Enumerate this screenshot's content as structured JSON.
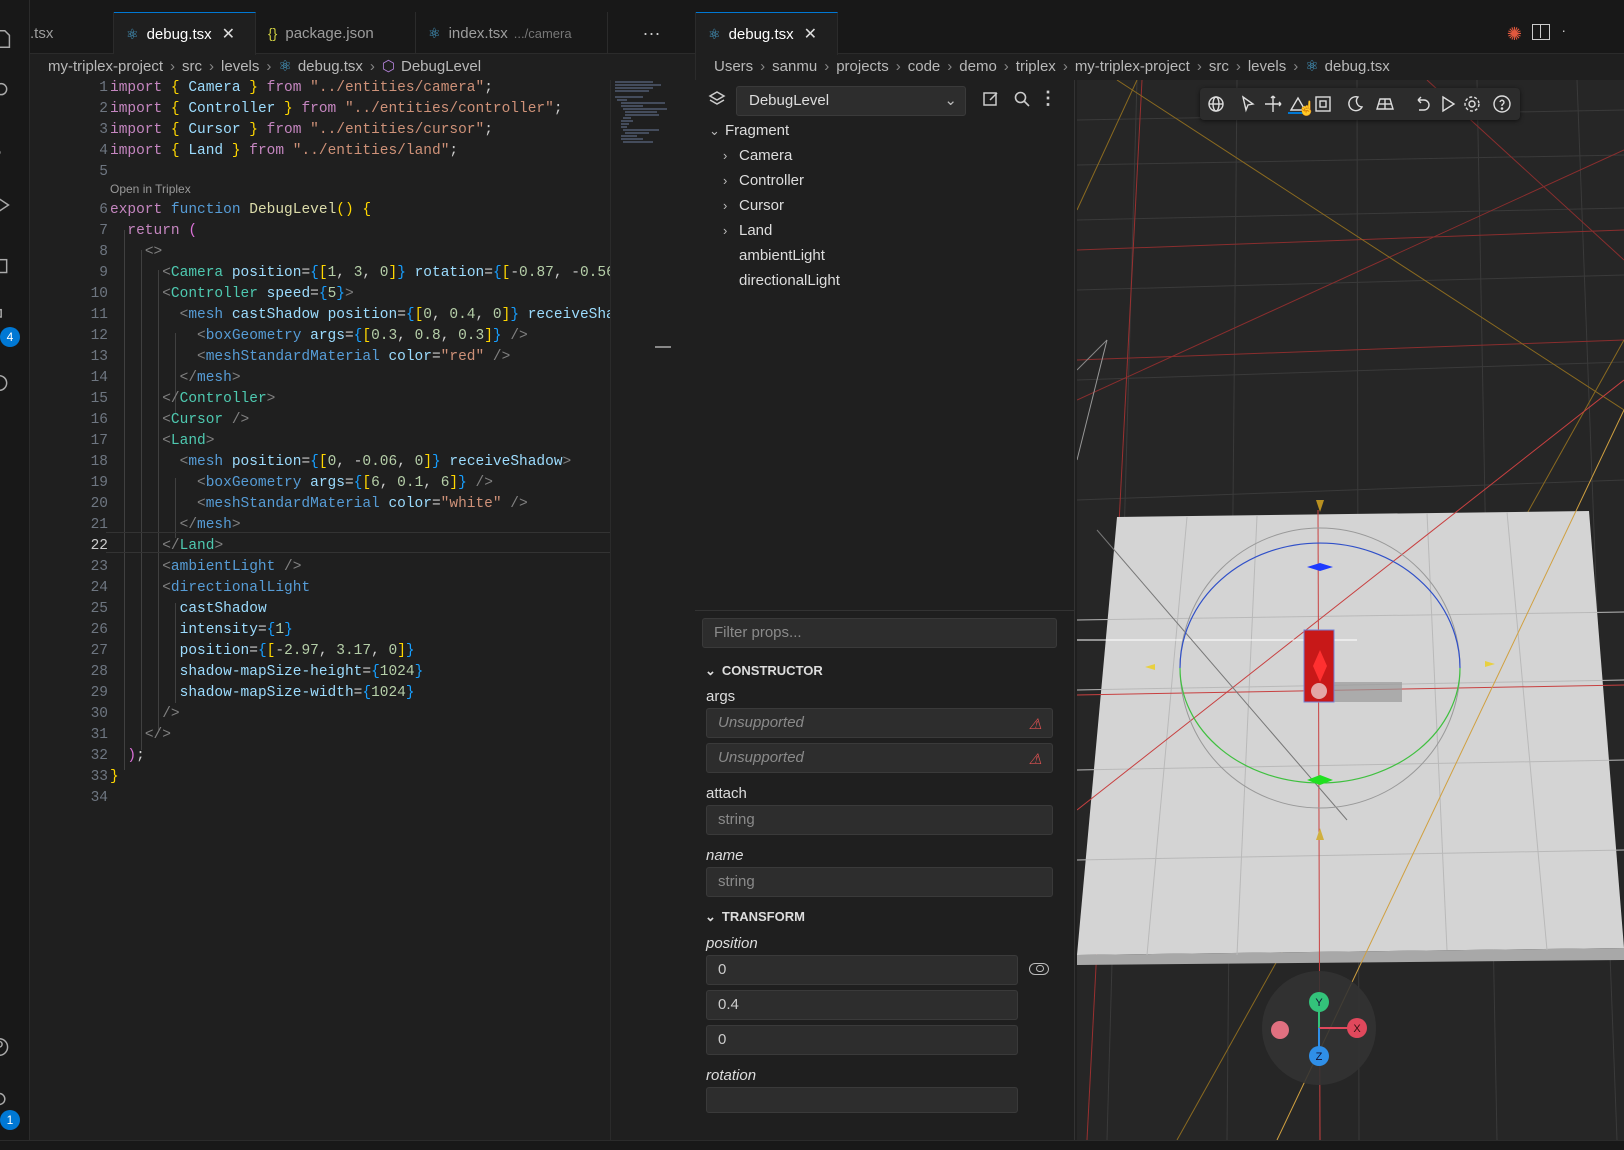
{
  "tabs_left": [
    {
      "name": "tab-partial-tsx",
      "label": ".tsx",
      "icon": "",
      "active": false,
      "close": false,
      "desc": ""
    },
    {
      "name": "tab-debug-tsx",
      "label": "debug.tsx",
      "icon": "react-icon",
      "active": true,
      "close": true,
      "desc": ""
    },
    {
      "name": "tab-package-json",
      "label": "package.json",
      "icon": "json-icon",
      "active": false,
      "close": false,
      "desc": ""
    },
    {
      "name": "tab-index-tsx",
      "label": "index.tsx",
      "icon": "react-icon",
      "active": false,
      "close": false,
      "desc": ".../camera"
    }
  ],
  "tabs_more": "···",
  "breadcrumb_left": [
    "my-triplex-project",
    "src",
    "levels",
    "debug.tsx",
    "DebugLevel"
  ],
  "code_lens": "Open in Triplex",
  "current_line": 22,
  "line_numbers": [
    "1",
    "2",
    "3",
    "4",
    "5",
    "6",
    "7",
    "8",
    "9",
    "10",
    "11",
    "12",
    "13",
    "14",
    "15",
    "16",
    "17",
    "18",
    "19",
    "20",
    "21",
    "22",
    "23",
    "24",
    "25",
    "26",
    "27",
    "28",
    "29",
    "30",
    "31",
    "32",
    "33",
    "34"
  ],
  "right_tab": {
    "label": "debug.tsx",
    "close": "✕"
  },
  "breadcrumb_right": [
    "Users",
    "sanmu",
    "projects",
    "code",
    "demo",
    "triplex",
    "my-triplex-project",
    "src",
    "levels",
    "debug.tsx"
  ],
  "scene": {
    "selector_value": "DebugLevel",
    "tree": [
      {
        "label": "Fragment",
        "expanded": true,
        "has_children": true,
        "depth": 0
      },
      {
        "label": "Camera",
        "expanded": false,
        "has_children": true,
        "depth": 1
      },
      {
        "label": "Controller",
        "expanded": false,
        "has_children": true,
        "depth": 1
      },
      {
        "label": "Cursor",
        "expanded": false,
        "has_children": true,
        "depth": 1
      },
      {
        "label": "Land",
        "expanded": false,
        "has_children": true,
        "depth": 1
      },
      {
        "label": "ambientLight",
        "expanded": false,
        "has_children": false,
        "depth": 1
      },
      {
        "label": "directionalLight",
        "expanded": false,
        "has_children": false,
        "depth": 1
      }
    ]
  },
  "props": {
    "filter_placeholder": "Filter props...",
    "constructor_title": "CONSTRUCTOR",
    "args_label": "args",
    "args_values": [
      "Unsupported",
      "Unsupported"
    ],
    "attach_label": "attach",
    "attach_placeholder": "string",
    "name_label": "name",
    "name_placeholder": "string",
    "transform_title": "TRANSFORM",
    "position_label": "position",
    "position_values": [
      "0",
      "0.4",
      "0"
    ],
    "rotation_label": "rotation"
  },
  "viewport": {
    "gizmo_axes": [
      "Y",
      "X",
      "Z"
    ],
    "toolbar_icons": [
      "globe-icon",
      "pointer-icon",
      "move-icon",
      "rotate-icon",
      "scale-icon",
      "moon-icon",
      "grid-icon",
      "undo-icon",
      "play-icon",
      "gear-icon",
      "help-icon"
    ]
  },
  "colors": {
    "accent": "#0078d4",
    "warning": "#e05252",
    "axis_x": "#e0485c",
    "axis_y": "#33c27a",
    "axis_z": "#2f8fe8",
    "box": "#d01818"
  }
}
